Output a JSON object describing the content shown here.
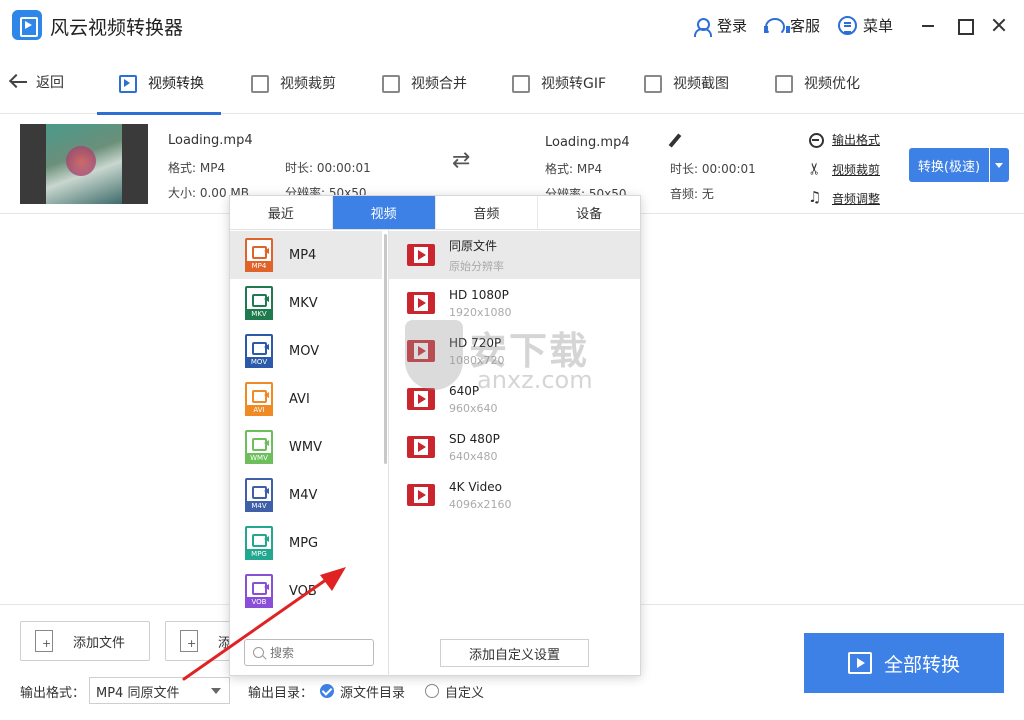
{
  "app": {
    "title": "风云视频转换器"
  },
  "topbar": {
    "login": "登录",
    "service": "客服",
    "menu": "菜单"
  },
  "nav": {
    "back": "返回",
    "tabs": [
      {
        "label": "视频转换"
      },
      {
        "label": "视频裁剪"
      },
      {
        "label": "视频合并"
      },
      {
        "label": "视频转GIF"
      },
      {
        "label": "视频截图"
      },
      {
        "label": "视频优化"
      }
    ]
  },
  "file": {
    "source": {
      "name": "Loading.mp4",
      "format": "格式: MP4",
      "duration": "时长: 00:00:01",
      "size": "大小: 0.00 MB",
      "resolution": "分辨率: 50x50"
    },
    "output": {
      "name": "Loading.mp4",
      "format": "格式: MP4",
      "duration": "时长: 00:00:01",
      "resolution": "分辨率: 50x50",
      "audio": "音频: 无"
    },
    "actions": {
      "output_format": "输出格式",
      "video_crop": "视频裁剪",
      "audio_adjust": "音频调整"
    },
    "convert_button": "转换(极速)"
  },
  "panel": {
    "tabs": [
      "最近",
      "视频",
      "音频",
      "设备"
    ],
    "active_tab": "视频",
    "formats": [
      {
        "label": "MP4",
        "tag": "MP4",
        "color": "#e0632a"
      },
      {
        "label": "MKV",
        "tag": "MKV",
        "color": "#1f7a4d"
      },
      {
        "label": "MOV",
        "tag": "MOV",
        "color": "#2b5aa8"
      },
      {
        "label": "AVI",
        "tag": "AVI",
        "color": "#f08a24"
      },
      {
        "label": "WMV",
        "tag": "WMV",
        "color": "#6cbf5a"
      },
      {
        "label": "M4V",
        "tag": "M4V",
        "color": "#3f5fa8"
      },
      {
        "label": "MPG",
        "tag": "MPG",
        "color": "#22a88f"
      },
      {
        "label": "VOB",
        "tag": "VOB",
        "color": "#8a4fd6"
      }
    ],
    "search_placeholder": "搜索",
    "presets": [
      {
        "name": "同原文件",
        "sub": "原始分辨率"
      },
      {
        "name": "HD 1080P",
        "sub": "1920x1080"
      },
      {
        "name": "HD 720P",
        "sub": "1080x720"
      },
      {
        "name": "640P",
        "sub": "960x640"
      },
      {
        "name": "SD 480P",
        "sub": "640x480"
      },
      {
        "name": "4K Video",
        "sub": "4096x2160"
      }
    ],
    "custom_button": "添加自定义设置"
  },
  "watermark": {
    "cn": "安下载",
    "en": "anxz.com"
  },
  "bottom": {
    "add_file": "添加文件",
    "add_folder": "添",
    "output_format_label": "输出格式：",
    "output_format_value": "MP4 同原文件",
    "output_dir_label": "输出目录：",
    "dir_source": "源文件目录",
    "dir_custom": "自定义",
    "convert_all": "全部转换"
  },
  "colors": {
    "accent": "#3d80e6",
    "arrow": "#e02222"
  }
}
